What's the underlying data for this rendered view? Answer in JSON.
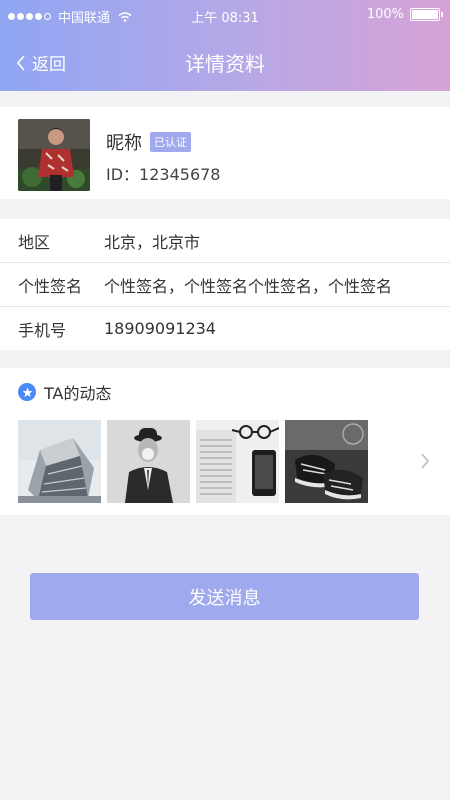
{
  "status_bar": {
    "carrier": "中国联通",
    "time": "上午 08:31",
    "battery": "100%"
  },
  "navbar": {
    "back_label": "返回",
    "title": "详情资料"
  },
  "profile": {
    "nickname": "昵称",
    "verified_badge": "已认证",
    "id_text": "ID：12345678"
  },
  "info": [
    {
      "label": "地区",
      "value": "北京，北京市"
    },
    {
      "label": "个性签名",
      "value": "个性签名，个性签名个性签名，个性签名"
    },
    {
      "label": "手机号",
      "value": "18909091234"
    }
  ],
  "moments": {
    "title": "TA的动态",
    "thumbnails": [
      "building-photo",
      "suit-man-photo",
      "phone-newspaper-photo",
      "sneakers-photo"
    ]
  },
  "actions": {
    "send_message": "发送消息"
  },
  "colors": {
    "header_gradient_start": "#8fa6f3",
    "header_gradient_end": "#d7a3d6",
    "button": "#9ea9ee",
    "badge": "#a0a8ee",
    "star_icon": "#4b89f4"
  }
}
